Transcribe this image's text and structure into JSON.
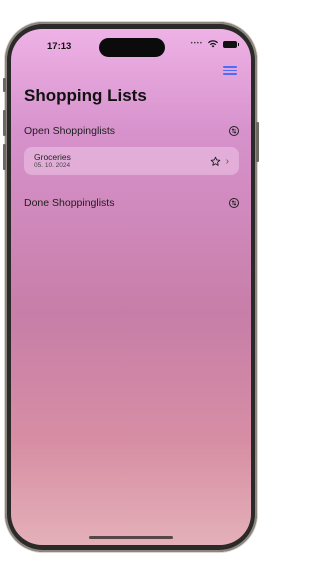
{
  "status_bar": {
    "time": "17:13",
    "signal_dots": "••••"
  },
  "header": {
    "title": "Shopping Lists",
    "menu_icon": "hamburger-icon",
    "accent": "#4f6cf6"
  },
  "open_section": {
    "label": "Open Shoppinglists",
    "icon": "sort-icon",
    "items": [
      {
        "name": "Groceries",
        "date": "05. 10. 2024",
        "favorite_icon": "star-icon",
        "chevron": "›"
      }
    ]
  },
  "done_section": {
    "label": "Done Shoppinglists",
    "icon": "sort-icon"
  }
}
